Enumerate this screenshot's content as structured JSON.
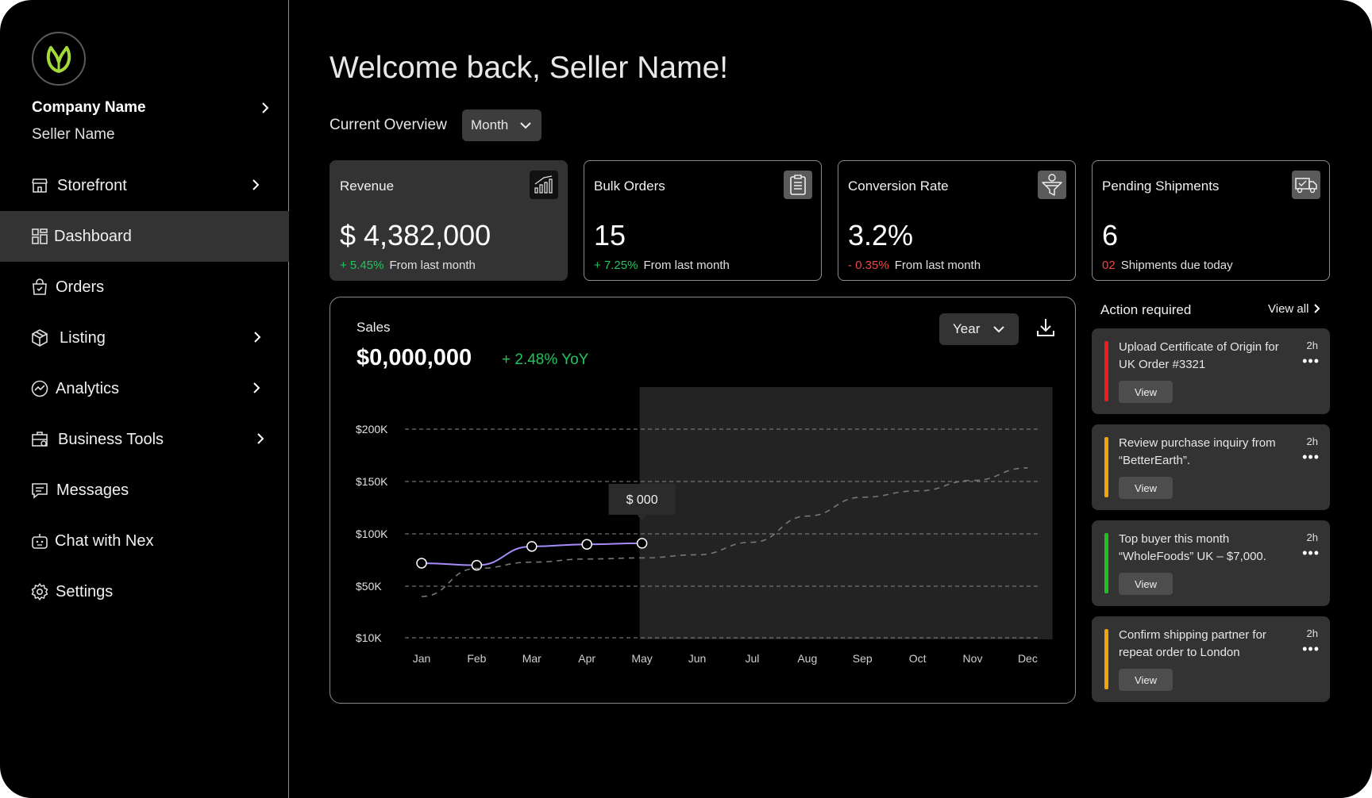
{
  "sidebar": {
    "company_name": "Company Name",
    "seller_name": "Seller Name",
    "items": [
      {
        "label": "Storefront",
        "icon": "storefront-icon",
        "has_chevron": true,
        "active": false
      },
      {
        "label": "Dashboard",
        "icon": "dashboard-icon",
        "has_chevron": false,
        "active": true
      },
      {
        "label": "Orders",
        "icon": "orders-bag-icon",
        "has_chevron": false,
        "active": false
      },
      {
        "label": "Listing",
        "icon": "package-icon",
        "has_chevron": true,
        "active": false
      },
      {
        "label": "Analytics",
        "icon": "analytics-icon",
        "has_chevron": true,
        "active": false
      },
      {
        "label": "Business Tools",
        "icon": "business-tools-icon",
        "has_chevron": true,
        "active": false
      },
      {
        "label": "Messages",
        "icon": "messages-icon",
        "has_chevron": false,
        "active": false
      },
      {
        "label": "Chat with Nex",
        "icon": "bot-icon",
        "has_chevron": false,
        "active": false
      },
      {
        "label": "Settings",
        "icon": "gear-icon",
        "has_chevron": false,
        "active": false
      }
    ]
  },
  "header": {
    "welcome": "Welcome back, Seller Name!",
    "overview_label": "Current Overview",
    "period": "Month"
  },
  "cards": [
    {
      "title": "Revenue",
      "value": "$ 4,382,000",
      "delta": "+ 5.45%",
      "delta_dir": "up",
      "note": "From last month",
      "icon": "bar-chart-icon"
    },
    {
      "title": "Bulk Orders",
      "value": "15",
      "delta": "+ 7.25%",
      "delta_dir": "up",
      "note": "From last month",
      "icon": "clipboard-icon"
    },
    {
      "title": "Conversion Rate",
      "value": "3.2%",
      "delta": "- 0.35%",
      "delta_dir": "down",
      "note": "From last month",
      "icon": "funnel-icon"
    },
    {
      "title": "Pending Shipments",
      "value": "6",
      "delta": "02",
      "delta_dir": "down",
      "note": "Shipments due today",
      "icon": "truck-icon"
    }
  ],
  "sales": {
    "title": "Sales",
    "amount": "$0,000,000",
    "yoy": "+ 2.48%  YoY",
    "period": "Year",
    "tooltip": "$ 000"
  },
  "chart_data": {
    "type": "line",
    "x": [
      "Jan",
      "Feb",
      "Mar",
      "Apr",
      "May",
      "Jun",
      "Jul",
      "Aug",
      "Sep",
      "Oct",
      "Nov",
      "Dec"
    ],
    "y_ticks": [
      "$10K",
      "$50K",
      "$100K",
      "$150K",
      "$200K"
    ],
    "series": [
      {
        "style": "solid",
        "color": "#a78bfa",
        "values": [
          72,
          70,
          88,
          90,
          91
        ]
      },
      {
        "style": "dashed",
        "color": "#777777",
        "values": [
          42,
          67,
          73,
          76,
          77,
          80,
          92,
          117,
          135,
          141,
          151,
          163
        ]
      }
    ],
    "tooltip_index": 4,
    "highlight_from": "May"
  },
  "actions": {
    "title": "Action required",
    "view_all": "View all",
    "items": [
      {
        "text": "Upload Certificate of Origin for UK Order #3321",
        "time": "2h",
        "button": "View",
        "color": "#ef1c1c"
      },
      {
        "text": "Review purchase inquiry from “BetterEarth”.",
        "time": "2h",
        "button": "View",
        "color": "#f0a30a"
      },
      {
        "text": "Top buyer this month “WholeFoods” UK – $7,000.",
        "time": "2h",
        "button": "View",
        "color": "#1fc01f"
      },
      {
        "text": "Confirm shipping partner for repeat order to London",
        "time": "2h",
        "button": "View",
        "color": "#f0a30a"
      }
    ]
  }
}
